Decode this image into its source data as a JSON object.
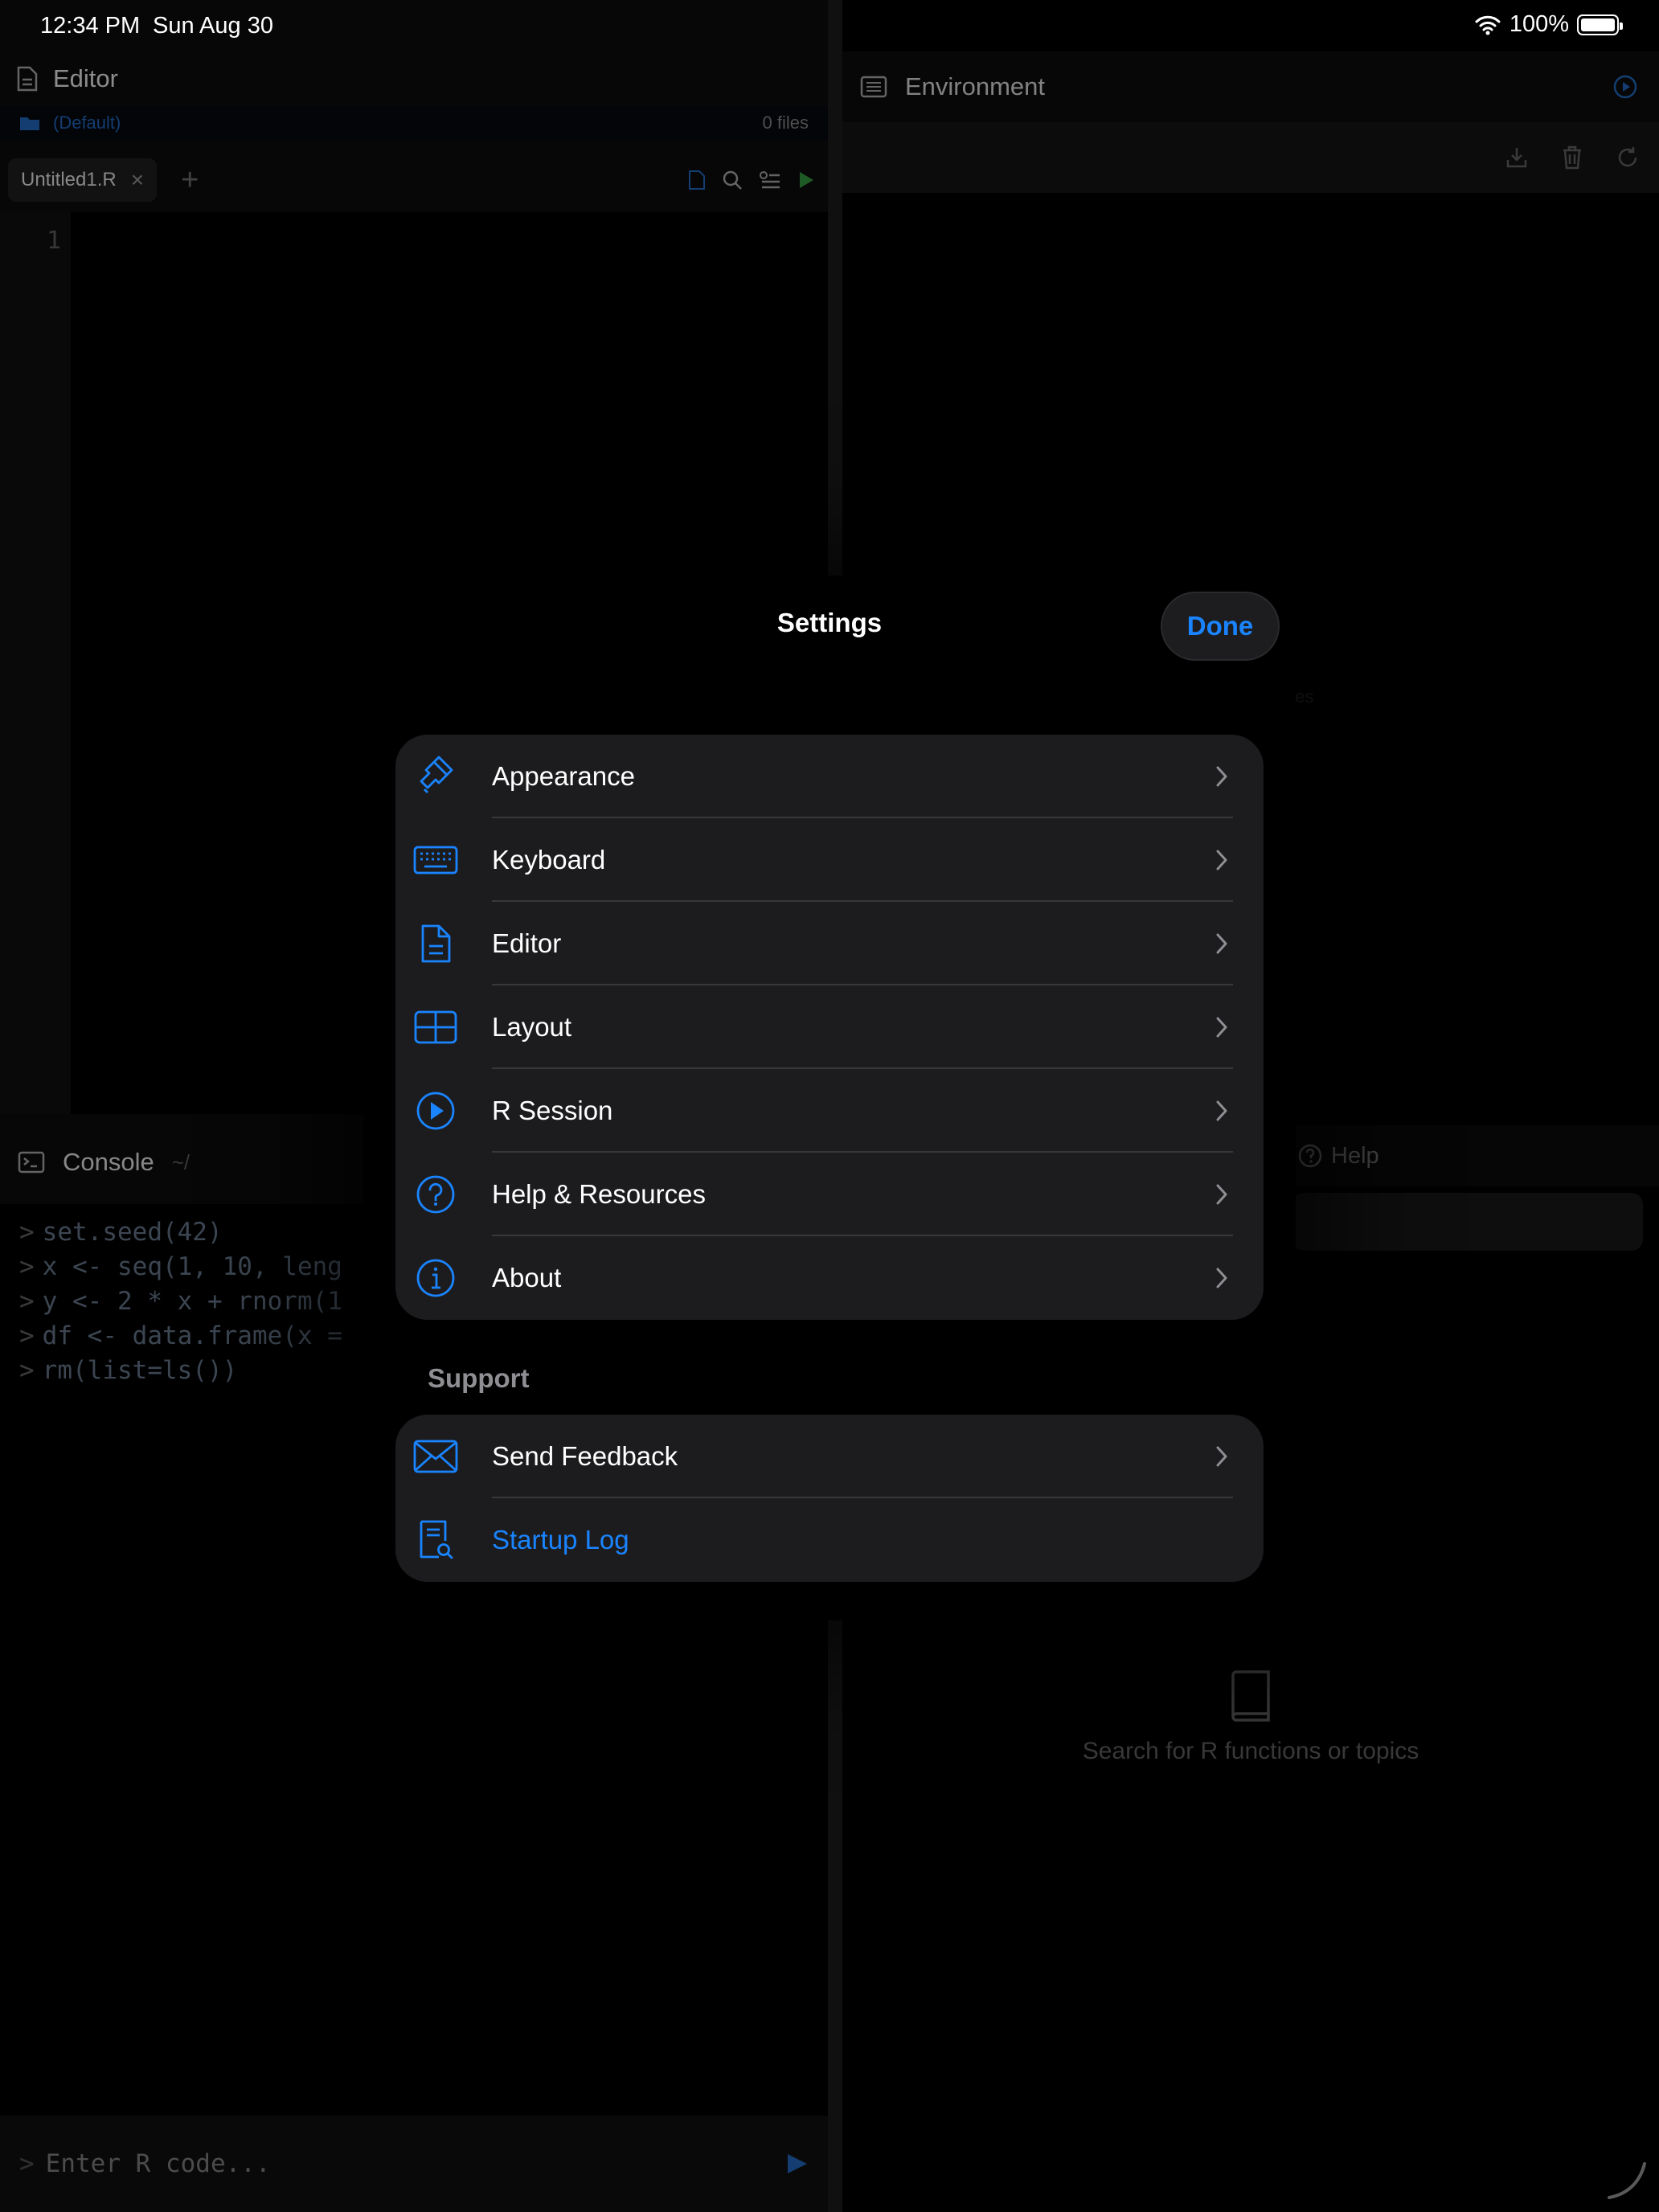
{
  "status_bar": {
    "time": "12:34 PM",
    "date": "Sun Aug 30",
    "battery": "100%"
  },
  "editor": {
    "title": "Editor",
    "project": {
      "name": "(Default)",
      "file_count": "0 files"
    },
    "tab": {
      "name": "Untitled1.R",
      "close_glyph": "×"
    },
    "add_tab_glyph": "+",
    "line_number": "1"
  },
  "console": {
    "title": "Console",
    "path": "~/",
    "prompt": ">",
    "lines": [
      "set.seed(42)",
      "x <- seq(1, 10, leng",
      "y <- 2 * x + rnorm(1",
      "df <- data.frame(x =",
      "rm(list=ls())"
    ],
    "input_placeholder": "Enter R code..."
  },
  "environment": {
    "title": "Environment",
    "empty_line_1": "s",
    "empty_line_2": "e variables"
  },
  "help": {
    "title": "Help",
    "empty_text": "Search for R functions or topics"
  },
  "settings": {
    "title": "Settings",
    "done_label": "Done",
    "main_items": [
      {
        "label": "Appearance",
        "icon": "paintbrush-icon"
      },
      {
        "label": "Keyboard",
        "icon": "keyboard-icon"
      },
      {
        "label": "Editor",
        "icon": "document-icon"
      },
      {
        "label": "Layout",
        "icon": "layout-grid-icon"
      },
      {
        "label": "R Session",
        "icon": "play-circle-icon"
      },
      {
        "label": "Help & Resources",
        "icon": "question-circle-icon"
      },
      {
        "label": "About",
        "icon": "info-circle-icon"
      }
    ],
    "support_header": "Support",
    "support_items": [
      {
        "label": "Send Feedback",
        "icon": "envelope-icon"
      },
      {
        "label": "Startup Log",
        "icon": "document-search-icon"
      }
    ]
  },
  "colors": {
    "accent": "#1a84ff",
    "row_bg": "#1c1c1e",
    "separator": "#38383a",
    "secondary_text": "#8e8e93"
  }
}
